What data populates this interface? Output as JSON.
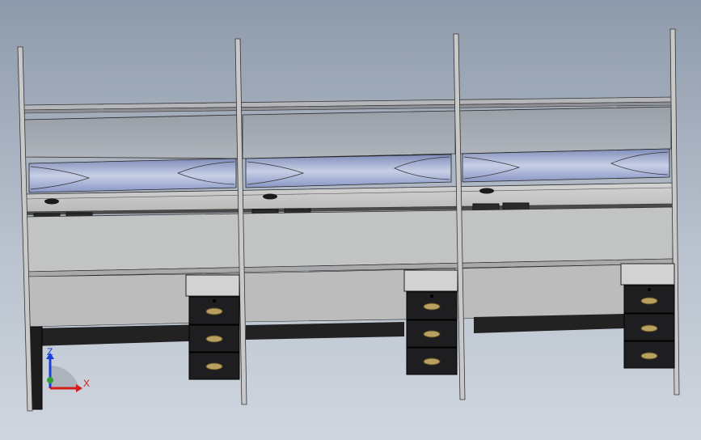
{
  "viewport": {
    "view": "front-trimetric",
    "background_top": "#8e9aab",
    "background_bottom": "#cfd6df"
  },
  "model": {
    "units": [
      {
        "name": "workstation-left",
        "drawer_count": 3
      },
      {
        "name": "workstation-center",
        "drawer_count": 3
      },
      {
        "name": "workstation-right",
        "drawer_count": 3
      }
    ],
    "colors": {
      "frame": "#c9c9c9",
      "panel": "#bfc0c0",
      "glass": "#9aa4b4",
      "drawer": "#1e1e20",
      "handle": "#b9a060",
      "light_box": "#8d9bc6"
    }
  },
  "triad": {
    "z_label": "Z",
    "x_label": "X",
    "z_color": "#1a3fd6",
    "x_color": "#d51b1b"
  }
}
